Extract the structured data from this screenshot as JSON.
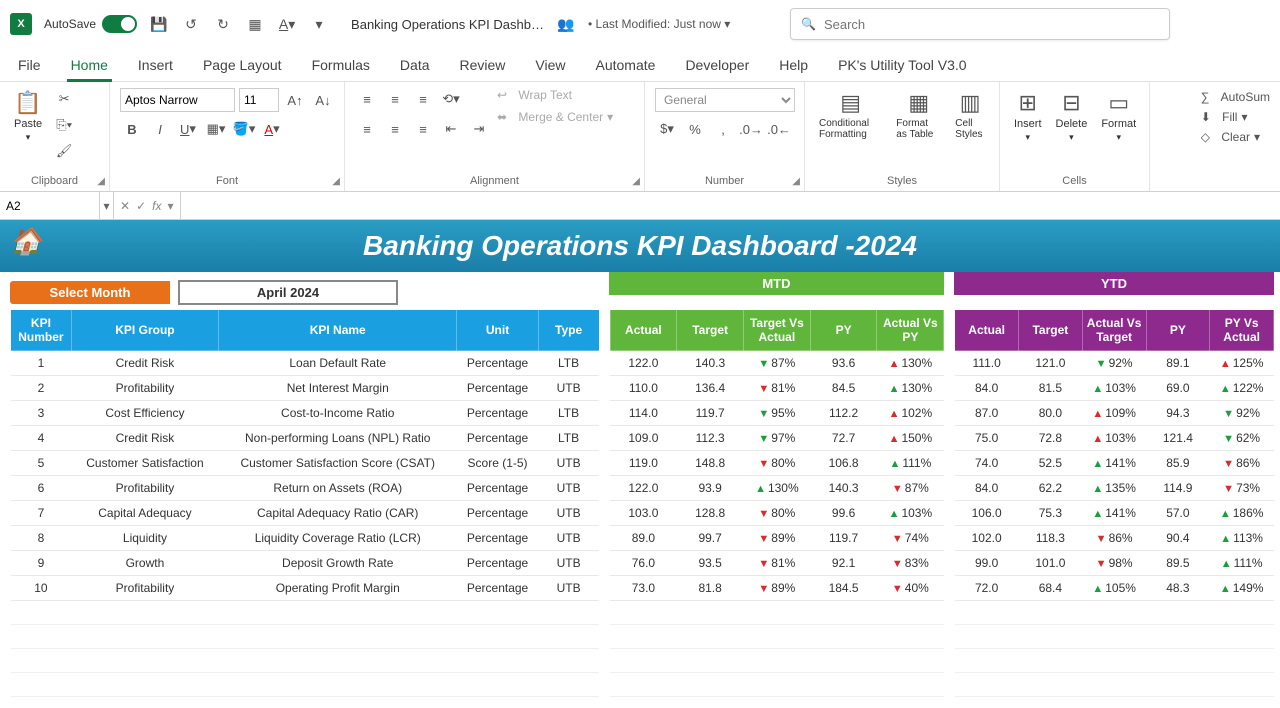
{
  "titlebar": {
    "autosave": "AutoSave",
    "autosave_on": "On",
    "doc_title": "Banking Operations KPI Dashb…",
    "modified_prefix": "• Last Modified: ",
    "modified_value": "Just now",
    "search_placeholder": "Search"
  },
  "tabs": [
    "File",
    "Home",
    "Insert",
    "Page Layout",
    "Formulas",
    "Data",
    "Review",
    "View",
    "Automate",
    "Developer",
    "Help",
    "PK's Utility Tool V3.0"
  ],
  "ribbon": {
    "clipboard": {
      "paste": "Paste",
      "label": "Clipboard"
    },
    "font": {
      "name": "Aptos Narrow",
      "size": "11",
      "label": "Font"
    },
    "alignment": {
      "wrap": "Wrap Text",
      "merge": "Merge & Center",
      "label": "Alignment"
    },
    "number": {
      "format": "General",
      "label": "Number"
    },
    "styles": {
      "cond": "Conditional Formatting",
      "fmt": "Format as Table",
      "cell": "Cell Styles",
      "label": "Styles"
    },
    "cells": {
      "insert": "Insert",
      "delete": "Delete",
      "format": "Format",
      "label": "Cells"
    },
    "editing": {
      "autosum": "AutoSum",
      "fill": "Fill",
      "clear": "Clear"
    }
  },
  "namebox": "A2",
  "dashboard": {
    "banner": "Banking Operations KPI Dashboard -2024",
    "select_label": "Select Month",
    "month": "April 2024",
    "mtd_label": "MTD",
    "ytd_label": "YTD",
    "left_headers": [
      "KPI Number",
      "KPI Group",
      "KPI Name",
      "Unit",
      "Type"
    ],
    "mtd_headers": [
      "Actual",
      "Target",
      "Target Vs Actual",
      "PY",
      "Actual Vs PY"
    ],
    "ytd_headers": [
      "Actual",
      "Target",
      "Actual Vs Target",
      "PY",
      "PY Vs Actual"
    ],
    "rows": [
      {
        "n": "1",
        "group": "Credit Risk",
        "name": "Loan Default Rate",
        "unit": "Percentage",
        "type": "LTB",
        "mtd": {
          "a": "122.0",
          "t": "140.3",
          "tva": "87%",
          "tvaDir": "dn",
          "py": "93.6",
          "avpy": "130%",
          "avpyDir": "up"
        },
        "ytd": {
          "a": "111.0",
          "t": "121.0",
          "avt": "92%",
          "avtDir": "dn",
          "py": "89.1",
          "pva": "125%",
          "pvaDir": "up"
        }
      },
      {
        "n": "2",
        "group": "Profitability",
        "name": "Net Interest Margin",
        "unit": "Percentage",
        "type": "UTB",
        "mtd": {
          "a": "110.0",
          "t": "136.4",
          "tva": "81%",
          "tvaDir": "dnR",
          "py": "84.5",
          "avpy": "130%",
          "avpyDir": "upG"
        },
        "ytd": {
          "a": "84.0",
          "t": "81.5",
          "avt": "103%",
          "avtDir": "upG",
          "py": "69.0",
          "pva": "122%",
          "pvaDir": "upG"
        }
      },
      {
        "n": "3",
        "group": "Cost Efficiency",
        "name": "Cost-to-Income Ratio",
        "unit": "Percentage",
        "type": "LTB",
        "mtd": {
          "a": "114.0",
          "t": "119.7",
          "tva": "95%",
          "tvaDir": "dn",
          "py": "112.2",
          "avpy": "102%",
          "avpyDir": "up"
        },
        "ytd": {
          "a": "87.0",
          "t": "80.0",
          "avt": "109%",
          "avtDir": "up",
          "py": "94.3",
          "pva": "92%",
          "pvaDir": "dn"
        }
      },
      {
        "n": "4",
        "group": "Credit Risk",
        "name": "Non-performing Loans (NPL) Ratio",
        "unit": "Percentage",
        "type": "LTB",
        "mtd": {
          "a": "109.0",
          "t": "112.3",
          "tva": "97%",
          "tvaDir": "dn",
          "py": "72.7",
          "avpy": "150%",
          "avpyDir": "up"
        },
        "ytd": {
          "a": "75.0",
          "t": "72.8",
          "avt": "103%",
          "avtDir": "up",
          "py": "121.4",
          "pva": "62%",
          "pvaDir": "dn"
        }
      },
      {
        "n": "5",
        "group": "Customer Satisfaction",
        "name": "Customer Satisfaction Score (CSAT)",
        "unit": "Score (1-5)",
        "type": "UTB",
        "mtd": {
          "a": "119.0",
          "t": "148.8",
          "tva": "80%",
          "tvaDir": "dnR",
          "py": "106.8",
          "avpy": "111%",
          "avpyDir": "upG"
        },
        "ytd": {
          "a": "74.0",
          "t": "52.5",
          "avt": "141%",
          "avtDir": "upG",
          "py": "85.9",
          "pva": "86%",
          "pvaDir": "dnR"
        }
      },
      {
        "n": "6",
        "group": "Profitability",
        "name": "Return on Assets (ROA)",
        "unit": "Percentage",
        "type": "UTB",
        "mtd": {
          "a": "122.0",
          "t": "93.9",
          "tva": "130%",
          "tvaDir": "upG",
          "py": "140.3",
          "avpy": "87%",
          "avpyDir": "dnR"
        },
        "ytd": {
          "a": "84.0",
          "t": "62.2",
          "avt": "135%",
          "avtDir": "upG",
          "py": "114.9",
          "pva": "73%",
          "pvaDir": "dnR"
        }
      },
      {
        "n": "7",
        "group": "Capital Adequacy",
        "name": "Capital Adequacy Ratio (CAR)",
        "unit": "Percentage",
        "type": "UTB",
        "mtd": {
          "a": "103.0",
          "t": "128.8",
          "tva": "80%",
          "tvaDir": "dnR",
          "py": "99.6",
          "avpy": "103%",
          "avpyDir": "upG"
        },
        "ytd": {
          "a": "106.0",
          "t": "75.3",
          "avt": "141%",
          "avtDir": "upG",
          "py": "57.0",
          "pva": "186%",
          "pvaDir": "upG"
        }
      },
      {
        "n": "8",
        "group": "Liquidity",
        "name": "Liquidity Coverage Ratio (LCR)",
        "unit": "Percentage",
        "type": "UTB",
        "mtd": {
          "a": "89.0",
          "t": "99.7",
          "tva": "89%",
          "tvaDir": "dnR",
          "py": "119.7",
          "avpy": "74%",
          "avpyDir": "dnR"
        },
        "ytd": {
          "a": "102.0",
          "t": "118.3",
          "avt": "86%",
          "avtDir": "dnR",
          "py": "90.4",
          "pva": "113%",
          "pvaDir": "upG"
        }
      },
      {
        "n": "9",
        "group": "Growth",
        "name": "Deposit Growth Rate",
        "unit": "Percentage",
        "type": "UTB",
        "mtd": {
          "a": "76.0",
          "t": "93.5",
          "tva": "81%",
          "tvaDir": "dnR",
          "py": "92.1",
          "avpy": "83%",
          "avpyDir": "dnR"
        },
        "ytd": {
          "a": "99.0",
          "t": "101.0",
          "avt": "98%",
          "avtDir": "dnR",
          "py": "89.5",
          "pva": "111%",
          "pvaDir": "upG"
        }
      },
      {
        "n": "10",
        "group": "Profitability",
        "name": "Operating Profit Margin",
        "unit": "Percentage",
        "type": "UTB",
        "mtd": {
          "a": "73.0",
          "t": "81.8",
          "tva": "89%",
          "tvaDir": "dnR",
          "py": "184.5",
          "avpy": "40%",
          "avpyDir": "dnR"
        },
        "ytd": {
          "a": "72.0",
          "t": "68.4",
          "avt": "105%",
          "avtDir": "upG",
          "py": "48.3",
          "pva": "149%",
          "pvaDir": "upG"
        }
      }
    ]
  }
}
